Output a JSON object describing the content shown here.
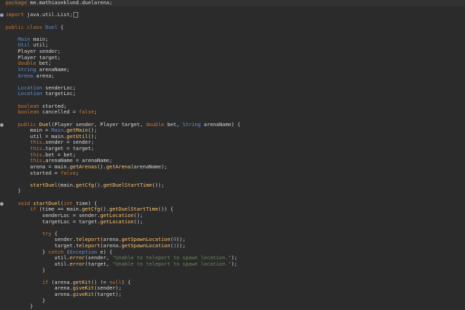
{
  "editor": {
    "lines": [
      [
        [
          "kw",
          "package "
        ],
        [
          "pl",
          "me.mathiaseklund.duelarena;"
        ]
      ],
      [],
      [
        [
          "kw",
          "import "
        ],
        [
          "pl",
          "java.util.List;"
        ],
        [
          "fold",
          ""
        ]
      ],
      [],
      [
        [
          "kw",
          "public class "
        ],
        [
          "ty",
          "Duel"
        ],
        [
          "pl",
          " {"
        ]
      ],
      [],
      [
        [
          "pl",
          "    "
        ],
        [
          "ty",
          "Main"
        ],
        [
          "pl",
          " main;"
        ]
      ],
      [
        [
          "pl",
          "    "
        ],
        [
          "ty",
          "Util"
        ],
        [
          "pl",
          " util;"
        ]
      ],
      [
        [
          "pl",
          "    Player sender;"
        ]
      ],
      [
        [
          "pl",
          "    Player target;"
        ]
      ],
      [
        [
          "pl",
          "    "
        ],
        [
          "kw",
          "double"
        ],
        [
          "pl",
          " bet;"
        ]
      ],
      [
        [
          "pl",
          "    "
        ],
        [
          "ty",
          "String"
        ],
        [
          "pl",
          " arenaName;"
        ]
      ],
      [
        [
          "pl",
          "    "
        ],
        [
          "ty",
          "Arena"
        ],
        [
          "pl",
          " arena;"
        ]
      ],
      [],
      [
        [
          "pl",
          "    "
        ],
        [
          "ty",
          "Location"
        ],
        [
          "pl",
          " senderLoc;"
        ]
      ],
      [
        [
          "pl",
          "    "
        ],
        [
          "ty",
          "Location"
        ],
        [
          "pl",
          " targetLoc;"
        ]
      ],
      [],
      [
        [
          "pl",
          "    "
        ],
        [
          "kw",
          "boolean"
        ],
        [
          "pl",
          " started;"
        ]
      ],
      [
        [
          "pl",
          "    "
        ],
        [
          "kw",
          "boolean"
        ],
        [
          "pl",
          " cancelled = "
        ],
        [
          "kw",
          "false"
        ],
        [
          "pl",
          ";"
        ]
      ],
      [],
      [
        [
          "pl",
          "    "
        ],
        [
          "kw",
          "public "
        ],
        [
          "fn",
          "Duel"
        ],
        [
          "pl",
          "(Player sender, Player target, "
        ],
        [
          "kw",
          "double"
        ],
        [
          "pl",
          " bet, "
        ],
        [
          "ty",
          "String"
        ],
        [
          "pl",
          " arenaName) {"
        ]
      ],
      [
        [
          "pl",
          "        main = "
        ],
        [
          "ty",
          "Main"
        ],
        [
          "pl",
          "."
        ],
        [
          "fn",
          "getMain"
        ],
        [
          "pl",
          "();"
        ]
      ],
      [
        [
          "pl",
          "        util = main."
        ],
        [
          "fn",
          "getUtil"
        ],
        [
          "pl",
          "();"
        ]
      ],
      [
        [
          "pl",
          "        "
        ],
        [
          "kw",
          "this"
        ],
        [
          "pl",
          ".sender = sender;"
        ]
      ],
      [
        [
          "pl",
          "        "
        ],
        [
          "kw",
          "this"
        ],
        [
          "pl",
          ".target = target;"
        ]
      ],
      [
        [
          "pl",
          "        "
        ],
        [
          "kw",
          "this"
        ],
        [
          "pl",
          ".bet = bet;"
        ]
      ],
      [
        [
          "pl",
          "        "
        ],
        [
          "kw",
          "this"
        ],
        [
          "pl",
          ".arenaName = arenaName;"
        ]
      ],
      [
        [
          "pl",
          "        arena = main."
        ],
        [
          "fn",
          "getArenas"
        ],
        [
          "pl",
          "()."
        ],
        [
          "fn",
          "getArena"
        ],
        [
          "pl",
          "(arenaName);"
        ]
      ],
      [
        [
          "pl",
          "        started = "
        ],
        [
          "kw",
          "false"
        ],
        [
          "pl",
          ";"
        ]
      ],
      [],
      [
        [
          "pl",
          "        "
        ],
        [
          "fn",
          "startDuel"
        ],
        [
          "pl",
          "(main."
        ],
        [
          "fn",
          "getCfg"
        ],
        [
          "pl",
          "()."
        ],
        [
          "fn",
          "getDuelStartTime"
        ],
        [
          "pl",
          "());"
        ]
      ],
      [
        [
          "pl",
          "    }"
        ]
      ],
      [],
      [
        [
          "pl",
          "    "
        ],
        [
          "kw",
          "void "
        ],
        [
          "fn",
          "startDuel"
        ],
        [
          "pl",
          "("
        ],
        [
          "kw",
          "int"
        ],
        [
          "pl",
          " time) {"
        ]
      ],
      [
        [
          "pl",
          "        "
        ],
        [
          "kw",
          "if"
        ],
        [
          "pl",
          " (time == main."
        ],
        [
          "fn",
          "getCfg"
        ],
        [
          "pl",
          "()."
        ],
        [
          "fn",
          "getDuelStartTime"
        ],
        [
          "pl",
          "()) {"
        ]
      ],
      [
        [
          "pl",
          "            senderLoc = sender."
        ],
        [
          "fn",
          "getLocation"
        ],
        [
          "pl",
          "();"
        ]
      ],
      [
        [
          "pl",
          "            targetLoc = target."
        ],
        [
          "fn",
          "getLocation"
        ],
        [
          "pl",
          "();"
        ]
      ],
      [],
      [
        [
          "pl",
          "            "
        ],
        [
          "kw",
          "try"
        ],
        [
          "pl",
          " {"
        ]
      ],
      [
        [
          "pl",
          "                sender."
        ],
        [
          "fn",
          "teleport"
        ],
        [
          "pl",
          "(arena."
        ],
        [
          "fn",
          "getSpawnLocation"
        ],
        [
          "pl",
          "("
        ],
        [
          "num",
          "0"
        ],
        [
          "pl",
          "));"
        ]
      ],
      [
        [
          "pl",
          "                target."
        ],
        [
          "fn",
          "teleport"
        ],
        [
          "pl",
          "(arena."
        ],
        [
          "fn",
          "getSpawnLocation"
        ],
        [
          "pl",
          "("
        ],
        [
          "num",
          "1"
        ],
        [
          "pl",
          "));"
        ]
      ],
      [
        [
          "pl",
          "            } "
        ],
        [
          "kw",
          "catch"
        ],
        [
          "pl",
          " ("
        ],
        [
          "ty",
          "Exception"
        ],
        [
          "pl",
          " e) {"
        ]
      ],
      [
        [
          "pl",
          "                util."
        ],
        [
          "fn",
          "error"
        ],
        [
          "pl",
          "(sender, "
        ],
        [
          "str",
          "\"Unable to teleport to spawn location.\""
        ],
        [
          "pl",
          ");"
        ]
      ],
      [
        [
          "pl",
          "                util."
        ],
        [
          "fn",
          "error"
        ],
        [
          "pl",
          "(target, "
        ],
        [
          "str",
          "\"Unable to teleport to spawn location.\""
        ],
        [
          "pl",
          ");"
        ]
      ],
      [
        [
          "pl",
          "            }"
        ]
      ],
      [],
      [
        [
          "pl",
          "            "
        ],
        [
          "kw",
          "if"
        ],
        [
          "pl",
          " (arena."
        ],
        [
          "fn",
          "getKit"
        ],
        [
          "pl",
          "() != "
        ],
        [
          "kw",
          "null"
        ],
        [
          "pl",
          ") {"
        ]
      ],
      [
        [
          "pl",
          "                arena."
        ],
        [
          "fn",
          "giveKit"
        ],
        [
          "pl",
          "(sender);"
        ]
      ],
      [
        [
          "pl",
          "                arena."
        ],
        [
          "fn",
          "giveKit"
        ],
        [
          "pl",
          "(target);"
        ]
      ],
      [
        [
          "pl",
          "            }"
        ]
      ],
      [
        [
          "pl",
          "        }"
        ]
      ]
    ],
    "current_line": 0,
    "marker_lines": [
      2,
      20,
      33
    ]
  }
}
